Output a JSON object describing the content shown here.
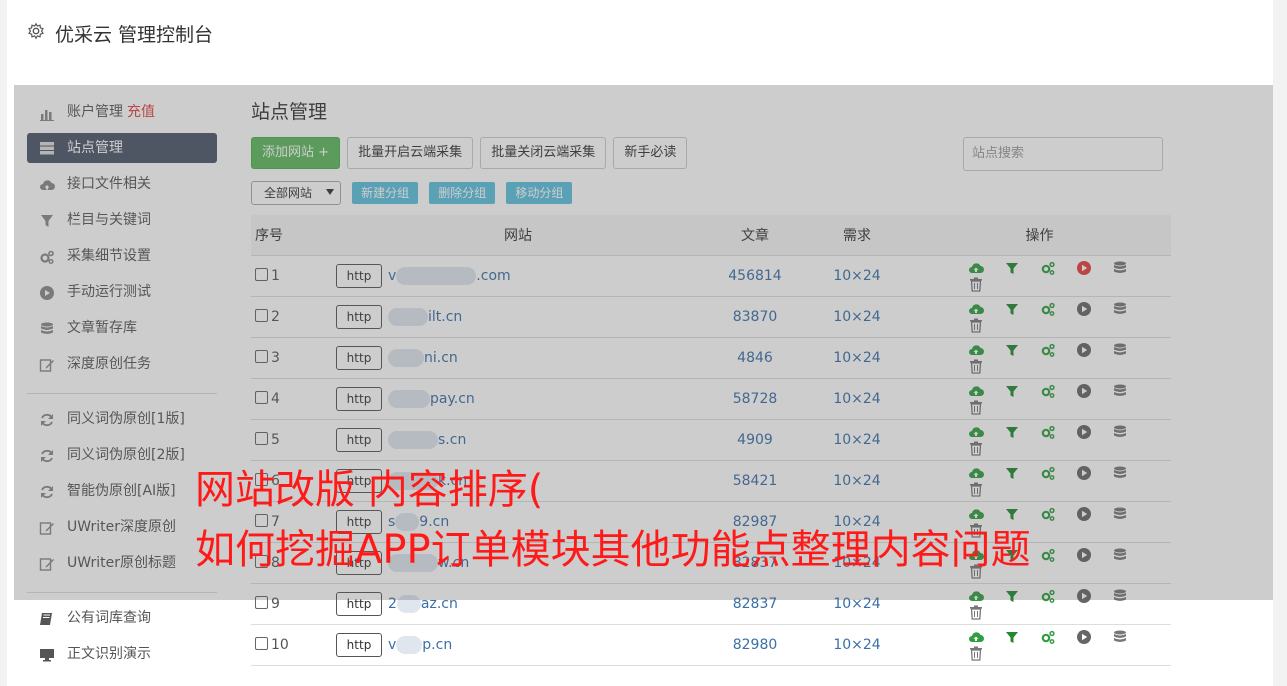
{
  "app": {
    "title": "优采云 管理控制台"
  },
  "sidebar": {
    "group1": [
      {
        "label": "账户管理",
        "extra": "充值",
        "icon": "bar-chart-icon"
      },
      {
        "label": "站点管理",
        "icon": "server-icon",
        "active": true
      },
      {
        "label": "接口文件相关",
        "icon": "cloud-upload-icon"
      },
      {
        "label": "栏目与关键词",
        "icon": "filter-icon"
      },
      {
        "label": "采集细节设置",
        "icon": "cogs-icon"
      },
      {
        "label": "手动运行测试",
        "icon": "play-circle-icon"
      },
      {
        "label": "文章暂存库",
        "icon": "database-icon"
      },
      {
        "label": "深度原创任务",
        "icon": "edit-icon"
      }
    ],
    "group2": [
      {
        "label": "同义词伪原创[1版]",
        "icon": "refresh-icon"
      },
      {
        "label": "同义词伪原创[2版]",
        "icon": "refresh-icon"
      },
      {
        "label": "智能伪原创[AI版]",
        "icon": "refresh-icon"
      },
      {
        "label": "UWriter深度原创",
        "icon": "edit-icon"
      },
      {
        "label": "UWriter原创标题",
        "icon": "edit-icon"
      }
    ],
    "group3": [
      {
        "label": "公有词库查询",
        "icon": "book-icon"
      },
      {
        "label": "正文识别演示",
        "icon": "monitor-icon"
      }
    ]
  },
  "main": {
    "title": "站点管理",
    "buttons": {
      "add": "添加网站 +",
      "batch_on": "批量开启云端采集",
      "batch_off": "批量关闭云端采集",
      "guide": "新手必读"
    },
    "search_placeholder": "站点搜索",
    "group_select": "全部网站",
    "group_buttons": {
      "new": "新建分组",
      "delete": "删除分组",
      "move": "移动分组"
    },
    "columns": {
      "idx": "序号",
      "site": "网站",
      "articles": "文章",
      "demand": "需求",
      "ops": "操作"
    },
    "rows": [
      {
        "idx": "1",
        "proto": "http",
        "site_prefix": "v",
        "site_suffix": ".com",
        "mask_w": 80,
        "articles": "456814",
        "demand": "10×24",
        "running": true
      },
      {
        "idx": "2",
        "proto": "http",
        "site_prefix": "",
        "site_suffix": "ilt.cn",
        "mask_w": 40,
        "articles": "83870",
        "demand": "10×24",
        "running": false
      },
      {
        "idx": "3",
        "proto": "http",
        "site_prefix": "",
        "site_suffix": "ni.cn",
        "mask_w": 36,
        "articles": "4846",
        "demand": "10×24",
        "running": false
      },
      {
        "idx": "4",
        "proto": "http",
        "site_prefix": "",
        "site_suffix": "pay.cn",
        "mask_w": 42,
        "articles": "58728",
        "demand": "10×24",
        "running": false
      },
      {
        "idx": "5",
        "proto": "http",
        "site_prefix": "",
        "site_suffix": "s.cn",
        "mask_w": 50,
        "articles": "4909",
        "demand": "10×24",
        "running": false
      },
      {
        "idx": "6",
        "proto": "http",
        "site_prefix": "",
        "site_suffix": "k.cn",
        "mask_w": 50,
        "articles": "58421",
        "demand": "10×24",
        "running": false
      },
      {
        "idx": "7",
        "proto": "http",
        "site_prefix": "s",
        "site_suffix": "9.cn",
        "mask_w": 24,
        "articles": "82987",
        "demand": "10×24",
        "running": false
      },
      {
        "idx": "8",
        "proto": "http",
        "site_prefix": "",
        "site_suffix": "w.cn",
        "mask_w": 50,
        "articles": "82837",
        "demand": "10×24",
        "running": false
      },
      {
        "idx": "9",
        "proto": "http",
        "site_prefix": "2",
        "site_suffix": "az.cn",
        "mask_w": 24,
        "articles": "82837",
        "demand": "10×24",
        "running": false
      },
      {
        "idx": "10",
        "proto": "http",
        "site_prefix": "v",
        "site_suffix": "p.cn",
        "mask_w": 26,
        "articles": "82980",
        "demand": "10×24",
        "running": false
      }
    ]
  },
  "overlay": {
    "line1": "网站改版 内容排序(",
    "line2": "如何挖掘APP订单模块其他功能点整理内容问题"
  },
  "colors": {
    "upload": "#2e9e3e",
    "filter": "#1f8a2f",
    "cogs": "#2e9e3e",
    "play_running": "#e53e3e",
    "play_idle": "#666",
    "db": "#777",
    "trash": "#777"
  }
}
